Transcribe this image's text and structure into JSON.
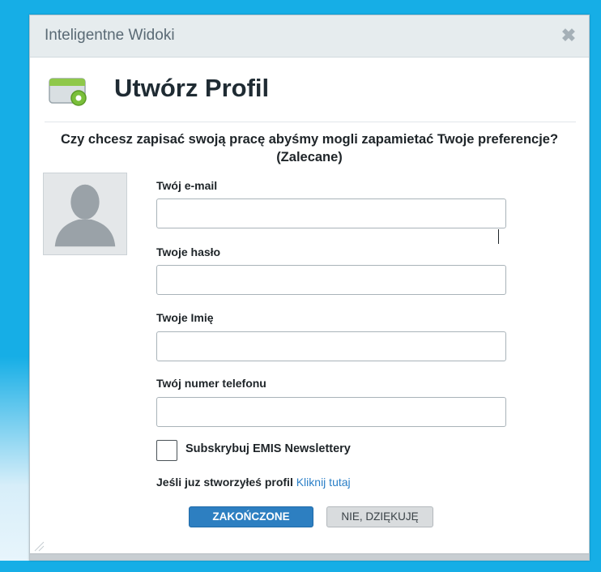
{
  "dialog": {
    "title": "Inteligentne Widoki",
    "close_glyph": "✖",
    "heading": "Utwórz Profil",
    "question": "Czy chcesz zapisać swoją pracę abyśmy mogli zapamietać Twoje preferencje? (Zalecane)"
  },
  "form": {
    "email": {
      "label": "Twój e-mail",
      "value": ""
    },
    "password": {
      "label": "Twoje hasło",
      "value": ""
    },
    "name": {
      "label": "Twoje Imię",
      "value": ""
    },
    "phone": {
      "label": "Twój numer telefonu",
      "value": ""
    },
    "newsletter": {
      "label": "Subskrybuj EMIS Newslettery",
      "checked": false
    }
  },
  "login": {
    "lead": "Jeśli juz stworzyłeś profil",
    "link": "Kliknij tutaj"
  },
  "buttons": {
    "finish": "ZAKOŃCZONE",
    "decline": "NIE, DZIĘKUJĘ"
  },
  "colors": {
    "background": "#16aee6",
    "primary_button": "#2d7fc1",
    "link": "#2b7fc7"
  },
  "icons": {
    "header": "profile-window-icon",
    "avatar": "user-silhouette-icon",
    "close": "close-icon"
  }
}
